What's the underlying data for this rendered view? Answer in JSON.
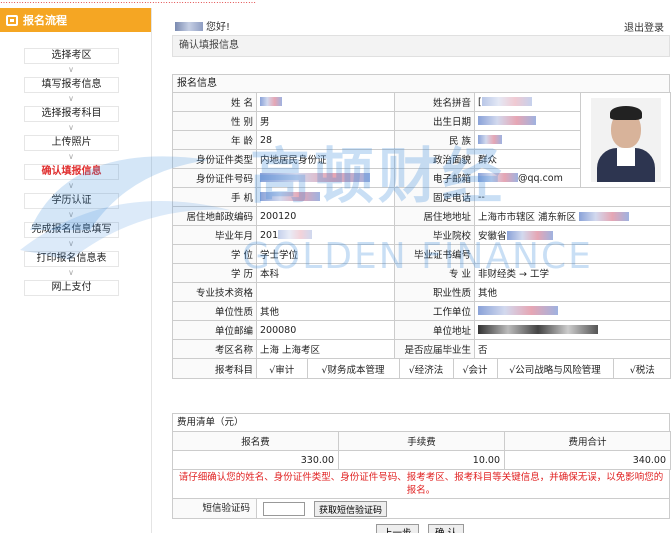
{
  "sidebar": {
    "title": "报名流程",
    "steps": [
      "选择考区",
      "填写报考信息",
      "选择报考科目",
      "上传照片",
      "确认填报信息",
      "学历认证",
      "完成报名信息填写",
      "打印报名信息表",
      "网上支付"
    ],
    "active_index": 4
  },
  "header": {
    "greeting": "您好!",
    "logout": "退出登录"
  },
  "confirm_title": "确认填报信息",
  "section_title": "报名信息",
  "info": {
    "name_lbl": "姓 名",
    "pinyin_lbl": "姓名拼音",
    "pinyin_val": "[",
    "gender_lbl": "性 别",
    "gender_val": "男",
    "birth_lbl": "出生日期",
    "age_lbl": "年 龄",
    "age_val": "28",
    "nation_lbl": "民 族",
    "idtype_lbl": "身份证件类型",
    "idtype_val": "内地居民身份证",
    "political_lbl": "政治面貌",
    "political_val": "群众",
    "idno_lbl": "身份证件号码",
    "email_lbl": "电子邮箱",
    "email_val": "@qq.com",
    "phone_lbl": "手 机",
    "tel_lbl": "固定电话",
    "tel_val": "--",
    "zip_lbl": "居住地邮政编码",
    "zip_val": "200120",
    "addr_lbl": "居住地地址",
    "addr_val": "上海市市辖区 浦东新区",
    "gradyear_lbl": "毕业年月",
    "gradyear_val": "201",
    "school_lbl": "毕业院校",
    "school_val": "安徽省",
    "degree_lbl": "学 位",
    "degree_val": "学士学位",
    "degreeno_lbl": "毕业证书编号",
    "edu_lbl": "学 历",
    "edu_val": "本科",
    "major_lbl": "专 业",
    "major_val": "非财经类 → 工学",
    "title_lbl": "专业技术资格",
    "job_lbl": "职业性质",
    "job_val": "其他",
    "unittype_lbl": "单位性质",
    "unittype_val": "其他",
    "unit_lbl": "工作单位",
    "unitzip_lbl": "单位邮编",
    "unitzip_val": "200080",
    "unitaddr_lbl": "单位地址",
    "area_lbl": "考区名称",
    "area_val": "上海 上海考区",
    "grad_lbl": "是否应届毕业生",
    "grad_val": "否",
    "courses_lbl": "报考科目",
    "courses": [
      "√审计",
      "√财务成本管理",
      "√经济法",
      "√会计",
      "√公司战略与风险管理",
      "√税法"
    ]
  },
  "fee": {
    "title": "费用清单（元）",
    "headers": [
      "报名费",
      "手续费",
      "费用合计"
    ],
    "values": [
      "330.00",
      "10.00",
      "340.00"
    ]
  },
  "warning": "请仔细确认您的姓名、身份证件类型、身份证件号码、报考考区、报考科目等关键信息，并确保无误，以免影响您的报名。",
  "sms": {
    "label": "短信验证码",
    "button": "获取短信验证码"
  },
  "buttons": {
    "prev": "上一步",
    "confirm": "确 认"
  },
  "watermark": {
    "cn": "高顿财经",
    "en": "GOLDEN FINANCE"
  },
  "colors": {
    "accent": "#f5a623",
    "warning": "#e02020",
    "active_step": "#e03030"
  }
}
